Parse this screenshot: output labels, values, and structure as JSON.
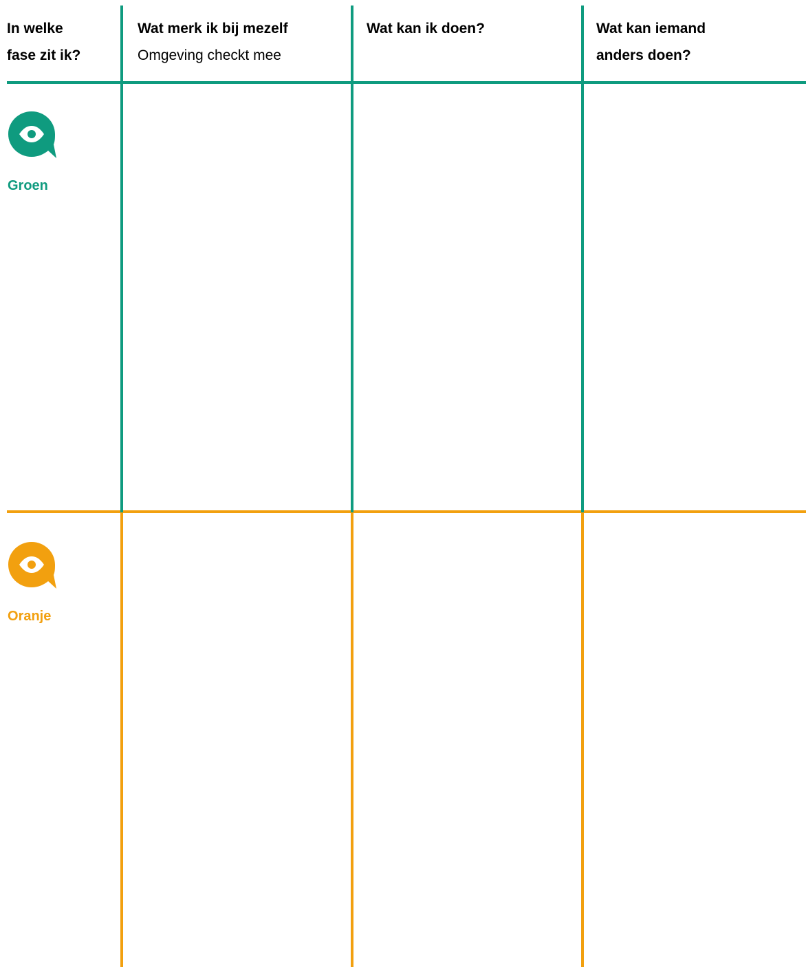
{
  "columns": [
    {
      "title_line1": "In welke",
      "title_line2": "fase zit ik?"
    },
    {
      "title": "Wat merk ik bij mezelf",
      "subtitle": "Omgeving checkt mee"
    },
    {
      "title": "Wat kan ik doen?"
    },
    {
      "title_line1": "Wat kan iemand",
      "title_line2": "anders doen?"
    }
  ],
  "phases": [
    {
      "label": "Groen",
      "color": "#0f9b7f",
      "icon": "eye-speech-bubble-icon"
    },
    {
      "label": "Oranje",
      "color": "#f2a00f",
      "icon": "eye-speech-bubble-icon"
    }
  ]
}
